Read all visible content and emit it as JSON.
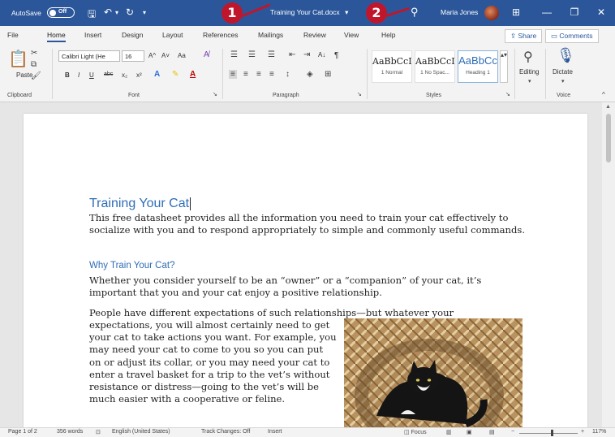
{
  "titlebar": {
    "autosave_label": "AutoSave",
    "autosave_state": "Off",
    "doc_title": "Training Your Cat.docx",
    "user_name": "Maria Jones",
    "undo_glyph": "↶",
    "redo_glyph": "↻",
    "save_glyph": "🖫",
    "more_glyph": "▾",
    "search_glyph": "⚲",
    "ribbon_display_glyph": "⊞",
    "minimize_glyph": "—",
    "restore_glyph": "❐",
    "close_glyph": "✕"
  },
  "callouts": {
    "one": "1",
    "two": "2",
    "color": "#c0162c"
  },
  "menu": {
    "tabs": [
      "File",
      "Home",
      "Insert",
      "Design",
      "Layout",
      "References",
      "Mailings",
      "Review",
      "View",
      "Help"
    ],
    "active_tab": "Home",
    "share_label": "Share",
    "comments_label": "Comments"
  },
  "ribbon": {
    "clipboard": {
      "paste_label": "Paste",
      "group_label": "Clipboard"
    },
    "font": {
      "font_name": "Calibri Light (He",
      "font_size": "16",
      "grow_label": "A^",
      "shrink_label": "A˅",
      "case_label": "Aa",
      "bold": "B",
      "italic": "I",
      "underline": "U",
      "strike": "abc",
      "subscript": "x₂",
      "superscript": "x²",
      "group_label": "Font"
    },
    "paragraph": {
      "group_label": "Paragraph",
      "sort_label": "A↓",
      "pilcrow": "¶"
    },
    "styles": {
      "cards": [
        {
          "sample": "AaBbCcI",
          "name": "1 Normal"
        },
        {
          "sample": "AaBbCcI",
          "name": "1 No Spac..."
        },
        {
          "sample": "AaBbCc",
          "name": "Heading 1"
        }
      ],
      "group_label": "Styles"
    },
    "editing": {
      "label": "Editing"
    },
    "voice": {
      "dictate_label": "Dictate",
      "group_label": "Voice"
    }
  },
  "document": {
    "title": "Training Your Cat",
    "intro": "This free datasheet provides all the information you need to train your cat effectively to socialize with you and to respond appropriately to simple and commonly useful commands.",
    "heading2": "Why Train Your Cat?",
    "para2": "Whether you consider yourself to be an “owner” or a “companion” of your cat, it’s important that you and your cat enjoy a positive relationship.",
    "para3_line1": "People have different expectations of such relationships—but whatever your",
    "para3_rest": "expectations, you will almost certainly need to get your cat to take actions you want. For example, you may need your cat to come to you so you can put on or adjust its collar, or you may need your cat to enter a travel basket for a trip to the vet’s without resistance or distress—going to the vet’s will be much easier with a cooperative or feline."
  },
  "status": {
    "page": "Page 1 of 2",
    "words": "356 words",
    "language": "English (United States)",
    "track_changes": "Track Changes: Off",
    "insert": "Insert",
    "focus": "Focus",
    "zoom": "117%"
  },
  "colors": {
    "titlebar": "#2b579a",
    "heading": "#2f6db5",
    "callout": "#c0162c"
  }
}
